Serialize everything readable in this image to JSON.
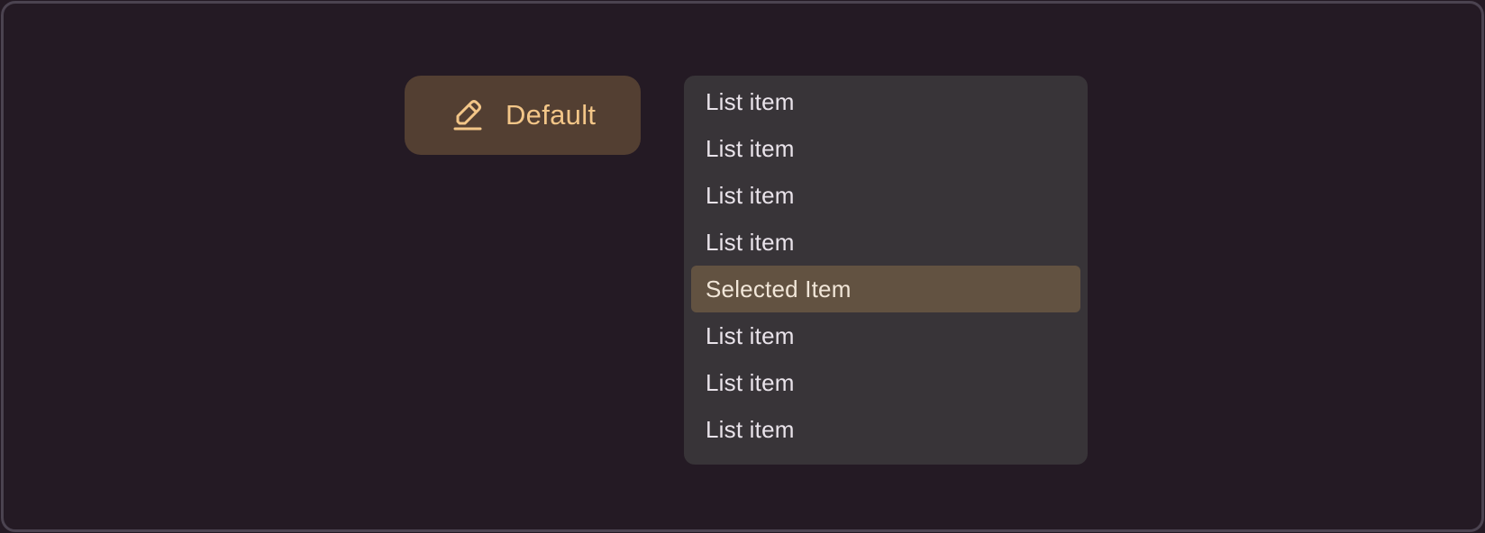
{
  "trigger": {
    "label": "Default",
    "icon": "pencil-icon"
  },
  "menu": {
    "items": [
      {
        "label": "List item",
        "selected": false
      },
      {
        "label": "List item",
        "selected": false
      },
      {
        "label": "List item",
        "selected": false
      },
      {
        "label": "List item",
        "selected": false
      },
      {
        "label": "Selected Item",
        "selected": true
      },
      {
        "label": "List item",
        "selected": false
      },
      {
        "label": "List item",
        "selected": false
      },
      {
        "label": "List item",
        "selected": false
      }
    ]
  },
  "colors": {
    "background": "#241a24",
    "frame_border": "#4b4350",
    "button_bg": "#533f32",
    "button_text": "#f3c688",
    "menu_bg": "#383438",
    "menu_text": "#e9e3ea",
    "selected_bg": "#625241"
  }
}
